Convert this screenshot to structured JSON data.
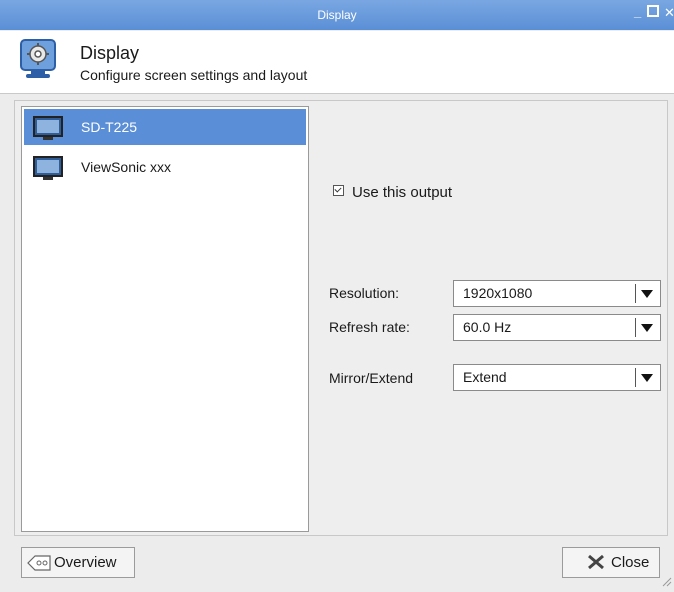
{
  "window": {
    "title": "Display"
  },
  "header": {
    "title": "Display",
    "subtitle": "Configure screen settings and layout",
    "icon": "display-settings-icon"
  },
  "outputs": {
    "items": [
      {
        "label": "SD-T225",
        "icon": "monitor-icon",
        "selected": true
      },
      {
        "label": "ViewSonic xxx",
        "icon": "monitor-icon",
        "selected": false
      }
    ]
  },
  "settings": {
    "use_output": {
      "label": "Use this output",
      "checked": true
    },
    "resolution": {
      "label": "Resolution:",
      "value": "1920x1080"
    },
    "refresh_rate": {
      "label": "Refresh rate:",
      "value": "60.0 Hz"
    },
    "mirror_extend": {
      "label": "Mirror/Extend",
      "value": "Extend"
    }
  },
  "buttons": {
    "overview": "Overview",
    "close": "Close"
  },
  "colors": {
    "titlebar": "#5a8fd6",
    "selection": "#5a8ed6"
  }
}
